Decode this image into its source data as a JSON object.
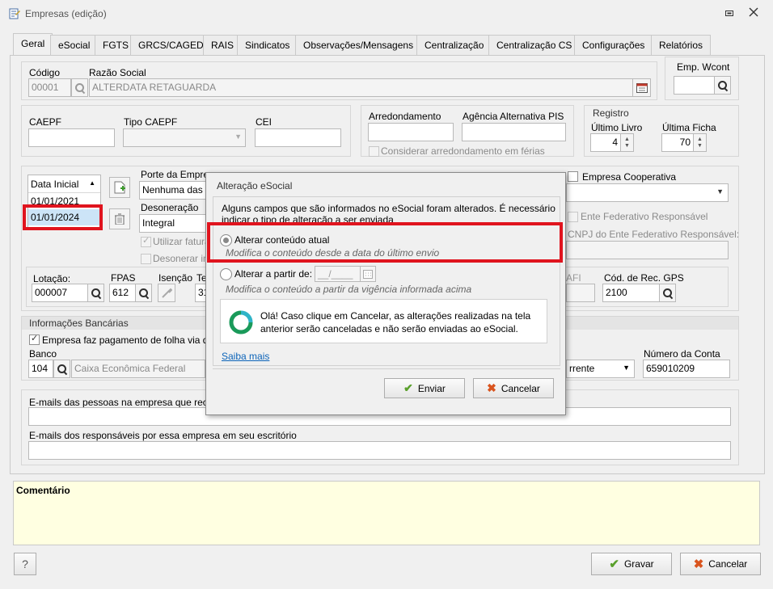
{
  "window": {
    "title": "Empresas (edição)"
  },
  "tabs": [
    "Geral",
    "eSocial",
    "FGTS",
    "GRCS/CAGED",
    "RAIS",
    "Sindicatos",
    "Observações/Mensagens",
    "Centralização",
    "Centralização CS",
    "Configurações",
    "Relatórios"
  ],
  "company": {
    "codigo_label": "Código",
    "codigo_value": "00001",
    "razao_label": "Razão Social",
    "razao_value": "ALTERDATA RETAGUARDA",
    "empwcont_label": "Emp. Wcont"
  },
  "caepf": {
    "caepf_label": "CAEPF",
    "tipo_label": "Tipo CAEPF",
    "cei_label": "CEI"
  },
  "arred": {
    "arred_label": "Arredondamento",
    "agencia_label": "Agência Alternativa PIS",
    "considerar_label": "Considerar arredondamento em férias"
  },
  "registro": {
    "title": "Registro",
    "livro_label": "Último Livro",
    "livro_value": "4",
    "ficha_label": "Última Ficha",
    "ficha_value": "70"
  },
  "dates": {
    "header": "Data Inicial",
    "rows": [
      "01/01/2021",
      "01/01/2024"
    ]
  },
  "porte": {
    "porte_label": "Porte da Empresa",
    "porte_value": "Nenhuma das",
    "deson_label": "Desoneração",
    "deson_value": "Integral",
    "utilizar_label": "Utilizar faturamento",
    "desonerar_label": "Desonerar in"
  },
  "coop": {
    "coop_label": "Empresa Cooperativa",
    "ente_label": "Ente Federativo Responsável",
    "cnpj_ente_label": "CNPJ do Ente Federativo Responsável:"
  },
  "lotacao": {
    "lot_label": "Lotação:",
    "lot_value": "000007",
    "fpas_label": "FPAS",
    "fpas_value": "612",
    "isencao_label": "Isenção",
    "te_label": "Te",
    "te_value": "31",
    "afi_label": "AFI",
    "gps_label": "Cód. de Rec. GPS",
    "gps_value": "2100"
  },
  "bank": {
    "title": "Informações Bancárias",
    "pagamento_label": "Empresa faz pagamento de folha via d",
    "banco_label": "Banco",
    "banco_code": "104",
    "banco_name": "Caixa Econômica Federal",
    "conta_tipo": "rrente",
    "numconta_label": "Número da Conta",
    "numconta_value": "659010209"
  },
  "emails": {
    "email1_label": "E-mails das pessoas na empresa que rece",
    "email2_label": "E-mails dos responsáveis por essa empresa em seu escritório"
  },
  "comment": {
    "label": "Comentário"
  },
  "footer": {
    "help": "?",
    "gravar": "Gravar",
    "cancelar": "Cancelar"
  },
  "dialog": {
    "title": "Alteração eSocial",
    "message_line1": "Alguns campos que são informados no eSocial foram alterados. É necessário",
    "message_line2": "indicar o tipo de alteração a ser enviada",
    "opt1_label": "Alterar conteúdo atual",
    "opt1_desc": "Modifica o conteúdo desde a data do último envio",
    "opt2_label": "Alterar a partir de:",
    "opt2_date_placeholder": "__/____",
    "opt2_desc": "Modifica o conteúdo a partir da vigência informada acima",
    "info_line1": "Olá! Caso clique em Cancelar, as alterações realizadas na tela",
    "info_line2": "anterior serão canceladas e não serão enviadas ao eSocial.",
    "saiba": "Saiba mais",
    "enviar": "Enviar",
    "cancelar": "Cancelar"
  },
  "colors": {
    "highlight_red": "#e0141e",
    "comment_bg": "#ffffe1",
    "accent_green": "#5aa02c",
    "link_blue": "#0b63b8"
  }
}
